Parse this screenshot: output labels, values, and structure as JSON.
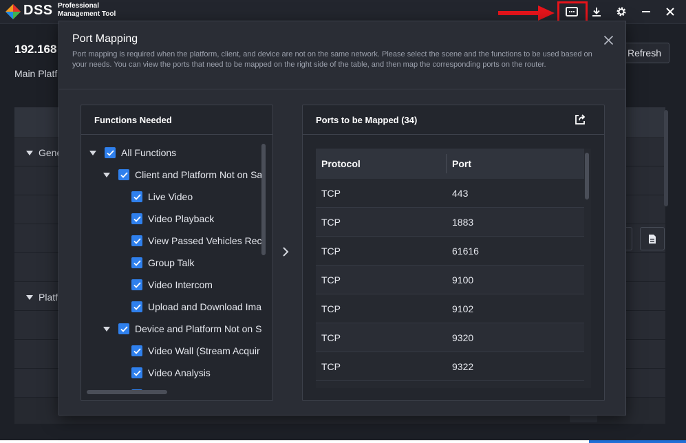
{
  "app": {
    "brand": "DSS",
    "brand_sub": "Professional Management Tool"
  },
  "background": {
    "ip": "192.168",
    "main_label": "Main Platf",
    "refresh_label": "Refresh",
    "section_1": "Gene",
    "section_2": "Platf"
  },
  "modal": {
    "title": "Port Mapping",
    "description": "Port mapping is required when the platform, client, and device are not on the same network. Please select the scene and the functions to be used based on your needs. You can view the ports that need to be mapped on the right side of the table, and then map the corresponding ports on the router.",
    "functions": {
      "title": "Functions Needed",
      "items": [
        {
          "label": "All Functions"
        },
        {
          "label": "Client and Platform Not on Sa"
        },
        {
          "label": "Live Video"
        },
        {
          "label": "Video Playback"
        },
        {
          "label": "View Passed Vehicles Reco"
        },
        {
          "label": "Group Talk"
        },
        {
          "label": "Video Intercom"
        },
        {
          "label": "Upload and Download Ima"
        },
        {
          "label": "Device and Platform Not on S"
        },
        {
          "label": "Video Wall (Stream Acquir"
        },
        {
          "label": "Video Analysis"
        }
      ]
    },
    "ports": {
      "title": "Ports to be Mapped (34)",
      "columns": [
        "Protocol",
        "Port"
      ],
      "rows": [
        [
          "TCP",
          "443"
        ],
        [
          "TCP",
          "1883"
        ],
        [
          "TCP",
          "61616"
        ],
        [
          "TCP",
          "9100"
        ],
        [
          "TCP",
          "9102"
        ],
        [
          "TCP",
          "9320"
        ],
        [
          "TCP",
          "9322"
        ]
      ]
    }
  },
  "colors": {
    "accent": "#2f80ed",
    "highlight": "#e8141b"
  }
}
